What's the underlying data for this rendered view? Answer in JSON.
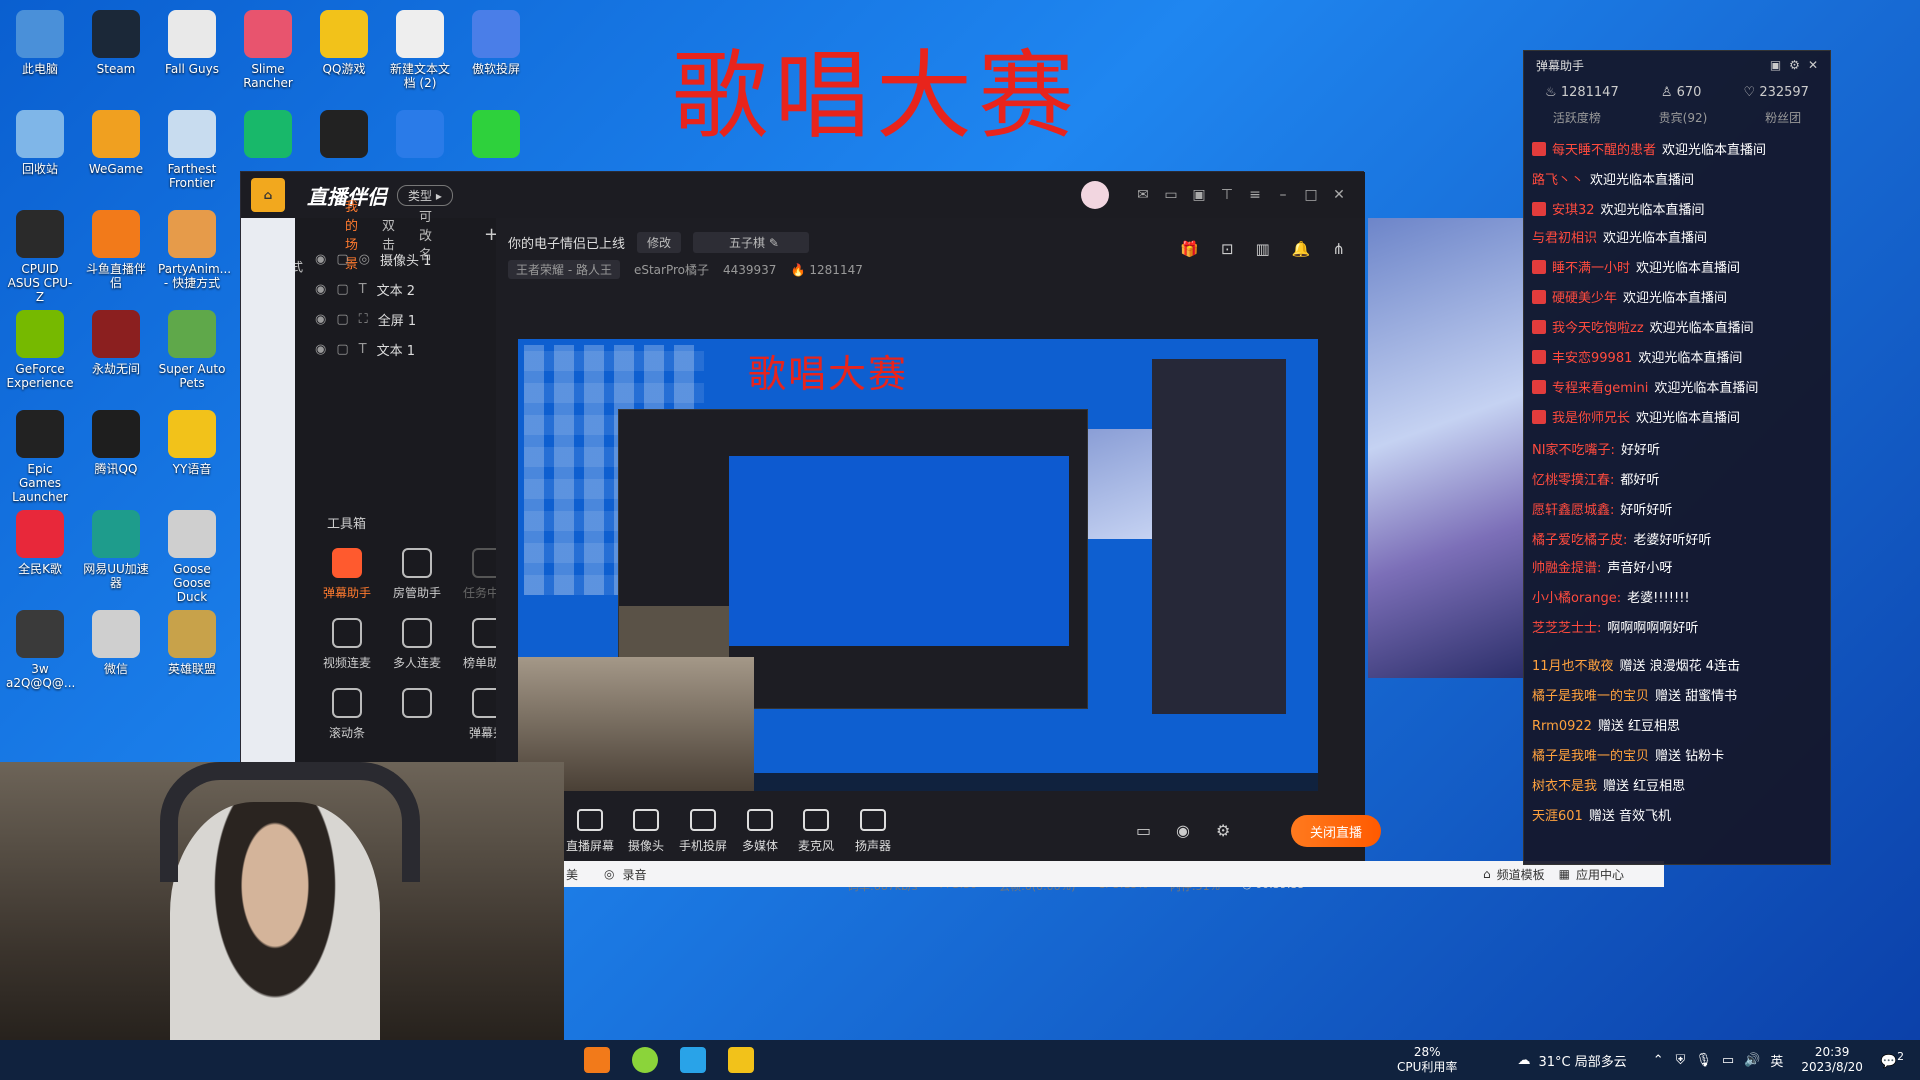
{
  "desktop": {
    "banner": "歌唱大赛",
    "icons": [
      {
        "label": "此电脑",
        "color": "#4a90d9"
      },
      {
        "label": "Steam",
        "color": "#1b2838"
      },
      {
        "label": "Fall Guys",
        "color": "#e9e9e9"
      },
      {
        "label": "Slime Rancher",
        "color": "#e8546e"
      },
      {
        "label": "QQ游戏",
        "color": "#f2c21a"
      },
      {
        "label": "新建文本文档 (2)",
        "color": "#eeeeee"
      },
      {
        "label": "傲软投屏",
        "color": "#4a7ee8"
      },
      {
        "label": "回收站",
        "color": "#7fb6e8"
      },
      {
        "label": "WeGame",
        "color": "#f0a020"
      },
      {
        "label": "Farthest Frontier",
        "color": "#c8dcef"
      },
      {
        "label": "",
        "color": "#18b86a"
      },
      {
        "label": "",
        "color": "#222222"
      },
      {
        "label": "",
        "color": "#2a7be8"
      },
      {
        "label": "",
        "color": "#2ed13c"
      },
      {
        "label": "CPUID ASUS CPU-Z",
        "color": "#2a2a2a"
      },
      {
        "label": "斗鱼直播伴侣",
        "color": "#f27a1a"
      },
      {
        "label": "PartyAnim... - 快捷方式",
        "color": "#e69b4a"
      },
      {
        "label": "GeForce Experience",
        "color": "#76b900"
      },
      {
        "label": "永劫无间",
        "color": "#8b1f1f"
      },
      {
        "label": "Super Auto Pets",
        "color": "#5fa84a"
      },
      {
        "label": "Epic Games Launcher",
        "color": "#222222"
      },
      {
        "label": "腾讯QQ",
        "color": "#1e1e1e"
      },
      {
        "label": "YY语音",
        "color": "#f2c21a"
      },
      {
        "label": "全民K歌",
        "color": "#e8283a"
      },
      {
        "label": "网易UU加速器",
        "color": "#1e9c8c"
      },
      {
        "label": "Goose Goose Duck",
        "color": "#cfcfcf"
      },
      {
        "label": "3w a2Q@Q@...",
        "color": "#3a3a3a"
      },
      {
        "label": "微信",
        "color": "#cfcfcf"
      },
      {
        "label": "英雄联盟",
        "color": "#c8a24a"
      }
    ]
  },
  "app": {
    "logo": "直播伴侣",
    "type_btn": "类型",
    "scene_tabs": [
      "我的场景",
      "双击",
      "可改名"
    ],
    "add": "+",
    "mode_label": "麦序模式",
    "sources": [
      "摄像头 1",
      "文本 2",
      "全屏 1",
      "文本 1"
    ],
    "title": "你的电子情侣已上线",
    "edit_btn": "修改",
    "category": "五子棋",
    "game": "王者荣耀 - 路人王",
    "room": "eStarPro橘子",
    "room_id": "4439937",
    "heat": "1281147",
    "toolbox": "工具箱",
    "tools": [
      {
        "label": "弹幕助手",
        "state": "hot"
      },
      {
        "label": "房管助手",
        "state": "normal"
      },
      {
        "label": "任务中心",
        "state": "dim"
      },
      {
        "label": "视频连麦",
        "state": "normal"
      },
      {
        "label": "多人连麦",
        "state": "normal"
      },
      {
        "label": "榜单助手",
        "state": "normal"
      },
      {
        "label": "滚动条",
        "state": "normal"
      },
      {
        "label": "",
        "state": "normal"
      },
      {
        "label": "弹幕秀",
        "state": "normal"
      }
    ],
    "preview_banner": "歌唱大赛",
    "controls": [
      "直播屏幕",
      "摄像头",
      "手机投屏",
      "多媒体",
      "麦克风",
      "扬声器"
    ],
    "go_live": "关闭直播",
    "status": {
      "bitrate": "码率:667kb/s",
      "fps": "FPS:30",
      "drop": "丢帧:0(0.00%)",
      "cpu": "CPU:15%",
      "mem": "内存:51%",
      "time": "00:39:35"
    },
    "strip": {
      "left": "美",
      "record": "录音",
      "template": "频道模板",
      "center": "应用中心"
    }
  },
  "chat": {
    "title": "弹幕助手",
    "stats": {
      "heat": "1281147",
      "viewers": "670",
      "likes": "232597"
    },
    "tabs": [
      "活跃度榜",
      "贵宾(92)",
      "粉丝团"
    ],
    "messages": [
      {
        "user": "每天睡不醒的患者",
        "text": "欢迎光临本直播间",
        "badge": true
      },
      {
        "user": "路飞丶丶",
        "text": "欢迎光临本直播间",
        "badge": false
      },
      {
        "user": "安琪32",
        "text": "欢迎光临本直播间",
        "badge": true
      },
      {
        "user": "与君初相识",
        "text": "欢迎光临本直播间",
        "badge": false
      },
      {
        "user": "睡不满一小时",
        "text": "欢迎光临本直播间",
        "badge": true
      },
      {
        "user": "硬硬美少年",
        "text": "欢迎光临本直播间",
        "badge": true
      },
      {
        "user": "我今天吃饱啦zz",
        "text": "欢迎光临本直播间",
        "badge": true
      },
      {
        "user": "丰安恋99981",
        "text": "欢迎光临本直播间",
        "badge": true
      },
      {
        "user": "专程来看gemini",
        "text": "欢迎光临本直播间",
        "badge": true
      },
      {
        "user": "我是你师兄长",
        "text": "欢迎光临本直播间",
        "badge": true
      },
      {
        "user": "NI家不吃嘴子:",
        "text": "好好听",
        "badge": false
      },
      {
        "user": "忆桃零摸江春:",
        "text": "都好听",
        "badge": false
      },
      {
        "user": "愿轩鑫愿城鑫:",
        "text": "好听好听",
        "badge": false
      },
      {
        "user": "橘子爱吃橘子皮:",
        "text": "老婆好听好听",
        "badge": false
      },
      {
        "user": "帅融金提谱:",
        "text": "声音好小呀",
        "badge": false
      },
      {
        "user": "小小橘orange:",
        "text": "老婆!!!!!!!",
        "badge": false
      },
      {
        "user": "芝芝芝士士:",
        "text": "啊啊啊啊啊好听",
        "badge": false
      },
      {
        "user": "11月也不敢夜",
        "text": "赠送 浪漫烟花 4连击",
        "badge": false
      },
      {
        "user": "橘子是我唯一的宝贝",
        "text": "赠送 甜蜜情书",
        "badge": false
      },
      {
        "user": "Rrm0922",
        "text": "赠送 红豆相思",
        "badge": false
      },
      {
        "user": "橘子是我唯一的宝贝",
        "text": "赠送 钻粉卡",
        "badge": false
      },
      {
        "user": "树衣不是我",
        "text": "赠送 红豆相思",
        "badge": false
      },
      {
        "user": "天涯601",
        "text": "赠送 音效飞机",
        "badge": false
      }
    ]
  },
  "taskbar": {
    "cpu_pct": "28%",
    "cpu_label": "CPU利用率",
    "weather": "31°C 局部多云",
    "ime": "英",
    "time": "20:39",
    "date": "2023/8/20",
    "notif": "2"
  }
}
